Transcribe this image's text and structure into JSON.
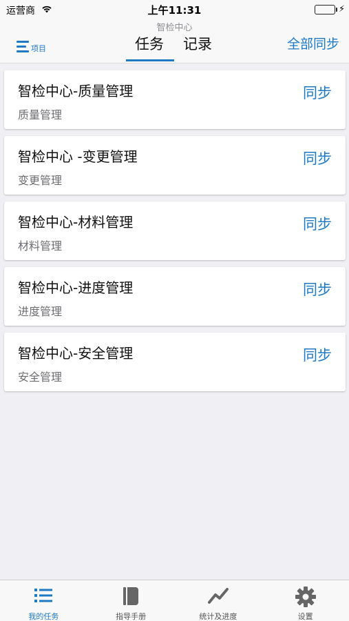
{
  "status_bar": {
    "carrier": "运营商",
    "time": "上午11:31"
  },
  "header": {
    "subtitle": "智检中心",
    "left_label": "项目",
    "tabs": [
      {
        "label": "任务",
        "active": true
      },
      {
        "label": "记录",
        "active": false
      }
    ],
    "right_action": "全部同步"
  },
  "tasks": [
    {
      "title": "智检中心-质量管理",
      "subtitle": "质量管理",
      "action": "同步"
    },
    {
      "title": "智检中心 -变更管理",
      "subtitle": "变更管理",
      "action": "同步"
    },
    {
      "title": "智检中心-材料管理",
      "subtitle": "材料管理",
      "action": "同步"
    },
    {
      "title": "智检中心-进度管理",
      "subtitle": "进度管理",
      "action": "同步"
    },
    {
      "title": "智检中心-安全管理",
      "subtitle": "安全管理",
      "action": "同步"
    }
  ],
  "tab_bar": [
    {
      "label": "我的任务",
      "icon": "list-icon",
      "active": true
    },
    {
      "label": "指导手册",
      "icon": "book-icon",
      "active": false
    },
    {
      "label": "统计及进度",
      "icon": "chart-line-icon",
      "active": false
    },
    {
      "label": "设置",
      "icon": "gear-icon",
      "active": false
    }
  ],
  "colors": {
    "accent": "#1e79c4",
    "background": "#efeff4",
    "battery": "#4cd964"
  }
}
